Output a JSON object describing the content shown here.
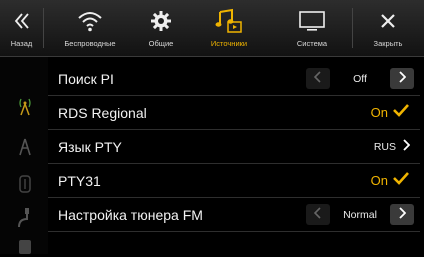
{
  "nav": {
    "back_label": "Назад",
    "wireless_label": "Беспроводные",
    "general_label": "Общие",
    "sources_label": "Источники",
    "system_label": "Система",
    "close_label": "Закрыть",
    "active_tab": "sources"
  },
  "settings": {
    "rows": [
      {
        "label": "Поиск PI",
        "value": "Off",
        "control": "stepper"
      },
      {
        "label": "RDS Regional",
        "value": "On",
        "control": "checkbox",
        "checked": true
      },
      {
        "label": "Язык PTY",
        "value": "RUS",
        "control": "submenu"
      },
      {
        "label": "PTY31",
        "value": "On",
        "control": "checkbox",
        "checked": true
      },
      {
        "label": "Настройка тюнера FM",
        "value": "Normal",
        "control": "stepper"
      }
    ]
  },
  "left_rail": {
    "icons": [
      "radio-tower-icon",
      "antenna-icon",
      "usb-icon",
      "aux-cable-icon",
      "bluetooth-audio-icon"
    ]
  },
  "colors": {
    "accent": "#f0b400",
    "background": "#000000",
    "row_divider": "#2e2e2e"
  }
}
